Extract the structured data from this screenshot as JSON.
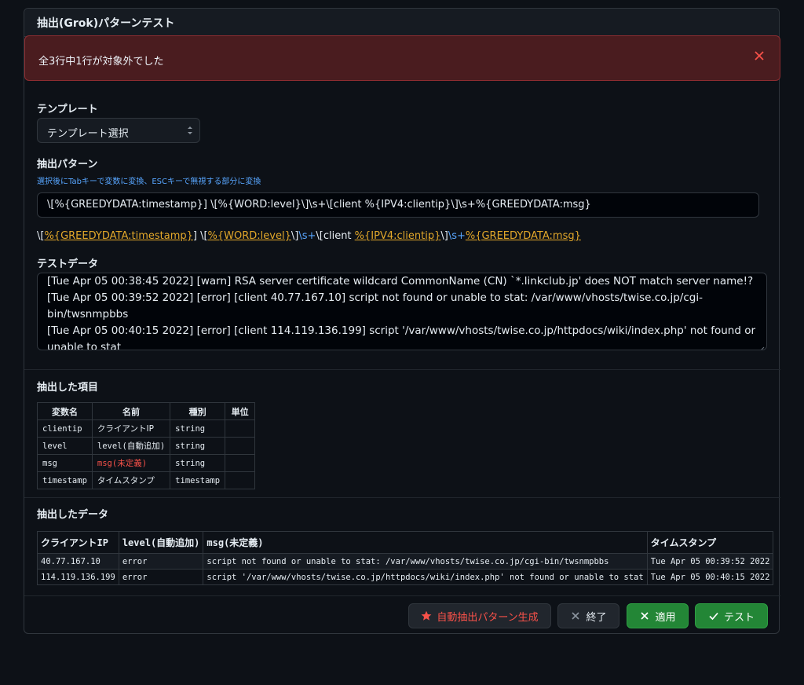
{
  "dialog": {
    "title": "抽出(Grok)パターンテスト"
  },
  "alert": {
    "message": "全3行中1行が対象外でした"
  },
  "template": {
    "label": "テンプレート",
    "selected": "テンプレート選択"
  },
  "pattern": {
    "label": "抽出パターン",
    "hint": "選択後にTabキーで変数に変換、ESCキーで無視する部分に変換",
    "value": "\\[%{GREEDYDATA:timestamp}] \\[%{WORD:level}\\]\\s+\\[client %{IPV4:clientip}\\]\\s+%{GREEDYDATA:msg}",
    "preview": {
      "p1": "\\[",
      "t1": "%{GREEDYDATA:timestamp}",
      "p2": "] \\[",
      "t2": "%{WORD:level}",
      "p3": "\\]",
      "e1": "\\s+",
      "p4": "\\[client ",
      "t3": "%{IPV4:clientip}",
      "p5": "\\]",
      "e2": "\\s+",
      "t4": "%{GREEDYDATA:msg}"
    }
  },
  "test_data": {
    "label": "テストデータ",
    "lines": [
      "[Tue Apr 05 00:38:45 2022] [warn] RSA server certificate wildcard CommonName (CN) `*.linkclub.jp' does NOT match server name!?",
      "[Tue Apr 05 00:39:52 2022] [error] [client 40.77.167.10] script not found or unable to stat: /var/www/vhosts/twise.co.jp/cgi-bin/twsnmpbbs",
      "[Tue Apr 05 00:40:15 2022] [error] [client 114.119.136.199] script '/var/www/vhosts/twise.co.jp/httpdocs/wiki/index.php' not found or unable to stat"
    ]
  },
  "items": {
    "label": "抽出した項目",
    "headers": [
      "変数名",
      "名前",
      "種別",
      "単位"
    ],
    "rows": [
      [
        "clientip",
        "クライアントIP",
        "string",
        ""
      ],
      [
        "level",
        "level(自動追加)",
        "string",
        ""
      ],
      [
        "msg",
        "msg(未定義)",
        "string",
        ""
      ],
      [
        "timestamp",
        "タイムスタンプ",
        "timestamp",
        ""
      ]
    ]
  },
  "data": {
    "label": "抽出したデータ",
    "headers": [
      "クライアントIP",
      "level(自動追加)",
      "msg(未定義)",
      "タイムスタンプ"
    ],
    "rows": [
      [
        "40.77.167.10",
        "error",
        "script not found or unable to stat: /var/www/vhosts/twise.co.jp/cgi-bin/twsnmpbbs",
        "Tue Apr 05 00:39:52 2022"
      ],
      [
        "114.119.136.199",
        "error",
        "script '/var/www/vhosts/twise.co.jp/httpdocs/wiki/index.php' not found or unable to stat",
        "Tue Apr 05 00:40:15 2022"
      ]
    ]
  },
  "buttons": {
    "auto": "自動抽出パターン生成",
    "close": "終了",
    "apply": "適用",
    "test": "テスト"
  },
  "colors": {
    "accent_green": "#238636",
    "danger": "#f85149",
    "token": "#e3a82a",
    "link": "#58a6ff"
  },
  "icons": {
    "alert_close": "close-icon",
    "select": "updown-arrows-icon",
    "auto": "star-icon",
    "close": "x-icon",
    "apply": "x-icon",
    "test": "check-icon"
  }
}
